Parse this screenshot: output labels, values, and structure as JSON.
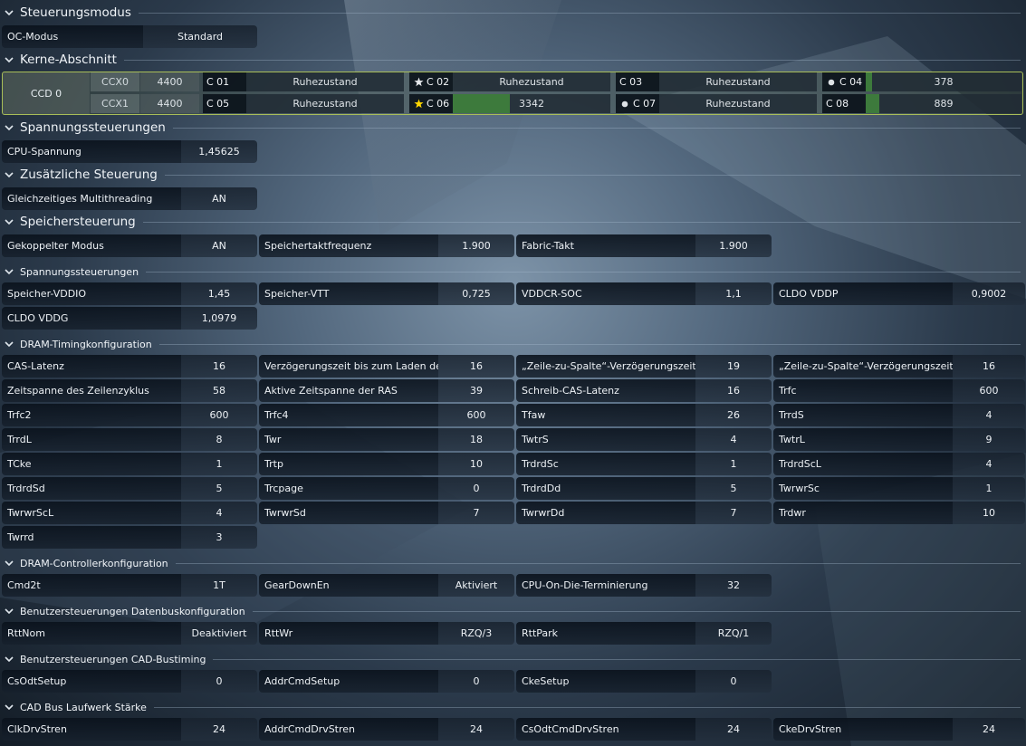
{
  "sections": {
    "steuerungsmodus": "Steuerungsmodus",
    "kerne": "Kerne-Abschnitt",
    "spannung": "Spannungssteuerungen",
    "zusatz": "Zusätzliche Steuerung",
    "speicher": "Speichersteuerung",
    "spannung2": "Spannungssteuerungen",
    "timing": "DRAM-Timingkonfiguration",
    "controller": "DRAM-Controllerkonfiguration",
    "datenbus": "Benutzersteuerungen Datenbuskonfiguration",
    "cad": "Benutzersteuerungen CAD-Bustiming",
    "cadbus": "CAD Bus Laufwerk Stärke"
  },
  "mode": {
    "label": "OC-Modus",
    "value": "Standard"
  },
  "ccd": {
    "label": "CCD 0",
    "ccx": [
      {
        "name": "CCX0",
        "freq": "4400"
      },
      {
        "name": "CCX1",
        "freq": "4400"
      }
    ],
    "cores": [
      {
        "name": "C 01",
        "value": "Ruhezustand",
        "marker": "none",
        "load": 0
      },
      {
        "name": "C 02",
        "value": "Ruhezustand",
        "marker": "star-outline-icon",
        "load": 0
      },
      {
        "name": "C 03",
        "value": "Ruhezustand",
        "marker": "none",
        "load": 0
      },
      {
        "name": "C 04",
        "value": "378",
        "marker": "dot-icon",
        "load": 0.04
      },
      {
        "name": "C 05",
        "value": "Ruhezustand",
        "marker": "none",
        "load": 0
      },
      {
        "name": "C 06",
        "value": "3342",
        "marker": "star-gold-icon",
        "load": 0.36
      },
      {
        "name": "C 07",
        "value": "Ruhezustand",
        "marker": "dot-icon",
        "load": 0
      },
      {
        "name": "C 08",
        "value": "889",
        "marker": "none",
        "load": 0.09
      }
    ]
  },
  "spannung": {
    "cpu": {
      "label": "CPU-Spannung",
      "value": "1,45625"
    }
  },
  "zusatz": {
    "smt": {
      "label": "Gleichzeitiges Multithreading",
      "value": "AN"
    }
  },
  "speicher": [
    {
      "label": "Gekoppelter Modus",
      "value": "AN"
    },
    {
      "label": "Speichertaktfrequenz",
      "value": "1.900"
    },
    {
      "label": "Fabric-Takt",
      "value": "1.900"
    }
  ],
  "spannung2": [
    {
      "label": "Speicher-VDDIO",
      "value": "1,45"
    },
    {
      "label": "Speicher-VTT",
      "value": "0,725"
    },
    {
      "label": "VDDCR-SOC",
      "value": "1,1"
    },
    {
      "label": "CLDO VDDP",
      "value": "0,9002"
    },
    {
      "label": "CLDO VDDG",
      "value": "1,0979"
    }
  ],
  "timing": [
    {
      "label": "CAS-Latenz",
      "value": "16"
    },
    {
      "label": "Verzögerungszeit bis zum Laden der ...",
      "value": "16"
    },
    {
      "label": "„Zeile-zu-Spalte“-Verzögerungszeit f...",
      "value": "19"
    },
    {
      "label": "„Zeile-zu-Spalte“-Verzögerungszeit f...",
      "value": "16"
    },
    {
      "label": "Zeitspanne des Zeilenzyklus",
      "value": "58"
    },
    {
      "label": "Aktive Zeitspanne der RAS",
      "value": "39"
    },
    {
      "label": "Schreib-CAS-Latenz",
      "value": "16"
    },
    {
      "label": "Trfc",
      "value": "600"
    },
    {
      "label": "Trfc2",
      "value": "600"
    },
    {
      "label": "Trfc4",
      "value": "600"
    },
    {
      "label": "Tfaw",
      "value": "26"
    },
    {
      "label": "TrrdS",
      "value": "4"
    },
    {
      "label": "TrrdL",
      "value": "8"
    },
    {
      "label": "Twr",
      "value": "18"
    },
    {
      "label": "TwtrS",
      "value": "4"
    },
    {
      "label": "TwtrL",
      "value": "9"
    },
    {
      "label": "TCke",
      "value": "1"
    },
    {
      "label": "Trtp",
      "value": "10"
    },
    {
      "label": "TrdrdSc",
      "value": "1"
    },
    {
      "label": "TrdrdScL",
      "value": "4"
    },
    {
      "label": "TrdrdSd",
      "value": "5"
    },
    {
      "label": "Trcpage",
      "value": "0"
    },
    {
      "label": "TrdrdDd",
      "value": "5"
    },
    {
      "label": "TwrwrSc",
      "value": "1"
    },
    {
      "label": "TwrwrScL",
      "value": "4"
    },
    {
      "label": "TwrwrSd",
      "value": "7"
    },
    {
      "label": "TwrwrDd",
      "value": "7"
    },
    {
      "label": "Trdwr",
      "value": "10"
    },
    {
      "label": "Twrrd",
      "value": "3"
    }
  ],
  "controller": [
    {
      "label": "Cmd2t",
      "value": "1T"
    },
    {
      "label": "GearDownEn",
      "value": "Aktiviert"
    },
    {
      "label": "CPU-On-Die-Terminierung",
      "value": "32"
    }
  ],
  "datenbus": [
    {
      "label": "RttNom",
      "value": "Deaktiviert"
    },
    {
      "label": "RttWr",
      "value": "RZQ/3"
    },
    {
      "label": "RttPark",
      "value": "RZQ/1"
    }
  ],
  "cad": [
    {
      "label": "CsOdtSetup",
      "value": "0"
    },
    {
      "label": "AddrCmdSetup",
      "value": "0"
    },
    {
      "label": "CkeSetup",
      "value": "0"
    }
  ],
  "cadbus": [
    {
      "label": "ClkDrvStren",
      "value": "24"
    },
    {
      "label": "AddrCmdDrvStren",
      "value": "24"
    },
    {
      "label": "CsOdtCmdDrvStren",
      "value": "24"
    },
    {
      "label": "CkeDrvStren",
      "value": "24"
    }
  ]
}
